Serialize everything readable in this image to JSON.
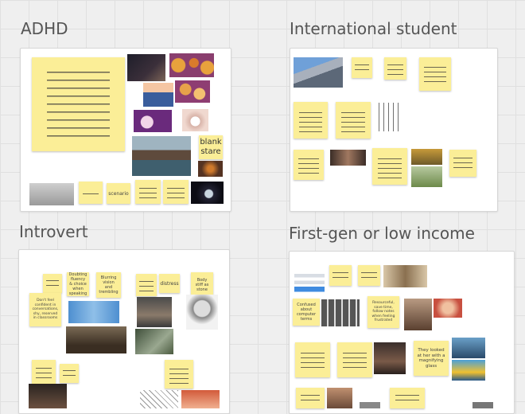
{
  "frames": {
    "adhd": {
      "title": "ADHD"
    },
    "international": {
      "title": "International student"
    },
    "introvert": {
      "title": "Introvert"
    },
    "firstgen": {
      "title": "First-gen or low income"
    }
  },
  "notes": {
    "blank_stare": "blank stare",
    "scenario": "scenario",
    "intro_a": "Don't feel confident in conversations, shy, reserved in classrooms",
    "intro_b": "Doubting fluency & choice when speaking",
    "intro_c": "Blurring vision and trembling",
    "intro_d": "distress",
    "intro_e": "Body stiff as stone",
    "fg_a": "Confused about computer terms",
    "fg_b": "Resourceful, save time, follow notes when feeling frustrated",
    "fg_c": "They looked at her with a magnifying glass"
  },
  "colors": {
    "note": "#fbee97",
    "canvas": "#efefef",
    "frame": "#ffffff"
  }
}
